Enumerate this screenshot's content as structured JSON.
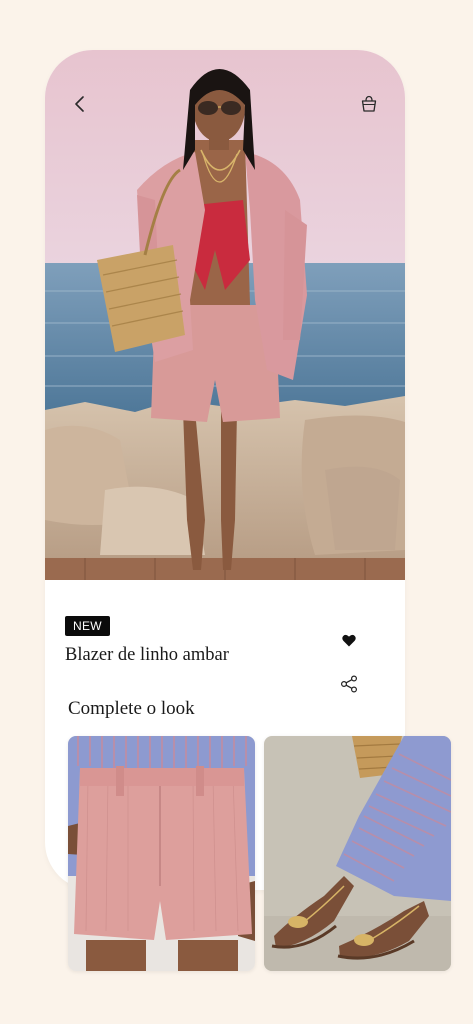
{
  "product": {
    "badge": "NEW",
    "name": "Blazer de linho ambar"
  },
  "section": {
    "title": "Complete o look"
  },
  "icons": {
    "back": "chevron-left-icon",
    "bag": "shopping-bag-icon",
    "favorite": "heart-icon",
    "share": "share-icon"
  },
  "colors": {
    "page_background": "#fbf3ea",
    "card_background": "#ffffff",
    "badge_background": "#0b0b0b",
    "blazer_pink": "#d99a9a",
    "sky_top": "#e9c6d0",
    "sea": "#5d86a6"
  },
  "complete_look": [
    {
      "item": "linen-shorts"
    },
    {
      "item": "gold-sandals"
    }
  ]
}
